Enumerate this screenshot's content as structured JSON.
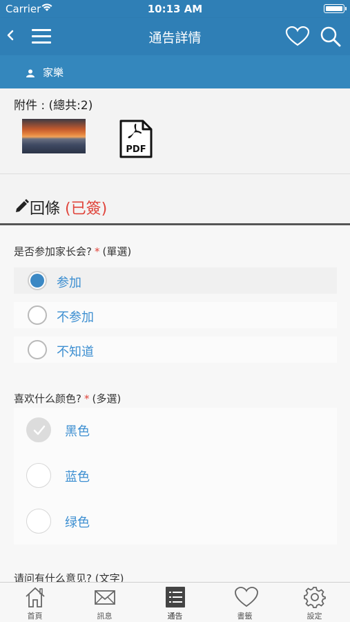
{
  "status": {
    "carrier": "Carrier",
    "time": "10:13 AM"
  },
  "nav": {
    "title": "通告詳情"
  },
  "sender": {
    "name": "家樂"
  },
  "attachments": {
    "label": "附件 : (總共:2)",
    "pdf_text": "PDF"
  },
  "reply": {
    "title": "回條",
    "status": "(已簽)"
  },
  "questions": [
    {
      "label": "是否参加家长会?",
      "type": "(單選)",
      "options": [
        {
          "label": "参加",
          "selected": true
        },
        {
          "label": "不参加",
          "selected": false
        },
        {
          "label": "不知道",
          "selected": false
        }
      ]
    },
    {
      "label": "喜欢什么颜色?",
      "type": "(多選)",
      "options": [
        {
          "label": "黑色",
          "checked": true
        },
        {
          "label": "蓝色",
          "checked": false
        },
        {
          "label": "绿色",
          "checked": false
        }
      ]
    },
    {
      "label": "请问有什么意见?",
      "type": "(文字)"
    }
  ],
  "tabs": [
    {
      "label": "首頁",
      "icon": "home-icon"
    },
    {
      "label": "訊息",
      "icon": "mail-icon"
    },
    {
      "label": "通告",
      "icon": "list-icon",
      "active": true
    },
    {
      "label": "書籤",
      "icon": "heart-icon"
    },
    {
      "label": "設定",
      "icon": "gear-icon"
    }
  ],
  "colors": {
    "header": "#2f7fb6",
    "accent": "#3d8fd1",
    "signed": "#e0443b"
  }
}
